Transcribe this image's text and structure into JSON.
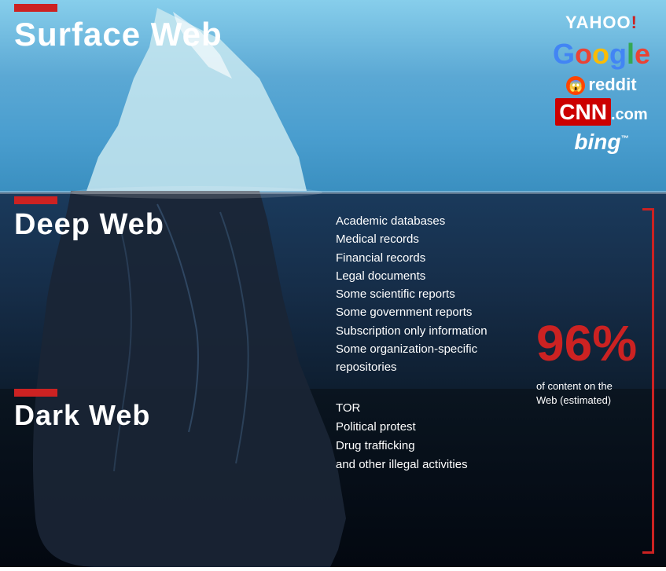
{
  "sections": {
    "surface": {
      "label": "Surface Web",
      "bar_id": "bar-surface"
    },
    "deep": {
      "label": "Deep Web",
      "bar_id": "bar-deep",
      "items": [
        "Academic databases",
        "Medical records",
        "Financial records",
        "Legal documents",
        "Some scientific reports",
        "Some government reports",
        "Subscription only information",
        "Some organization-specific",
        "repositories"
      ]
    },
    "dark": {
      "label": "Dark Web",
      "bar_id": "bar-dark",
      "items": [
        "TOR",
        "Political protest",
        "Drug trafficking",
        "and other illegal activities"
      ]
    }
  },
  "logos": {
    "yahoo": "YAHOO!",
    "google": "Google",
    "reddit": "reddit",
    "cnn": "CNN.com",
    "bing": "bing"
  },
  "stats": {
    "percentage": "96%",
    "description": "of content on the Web (estimated)"
  }
}
